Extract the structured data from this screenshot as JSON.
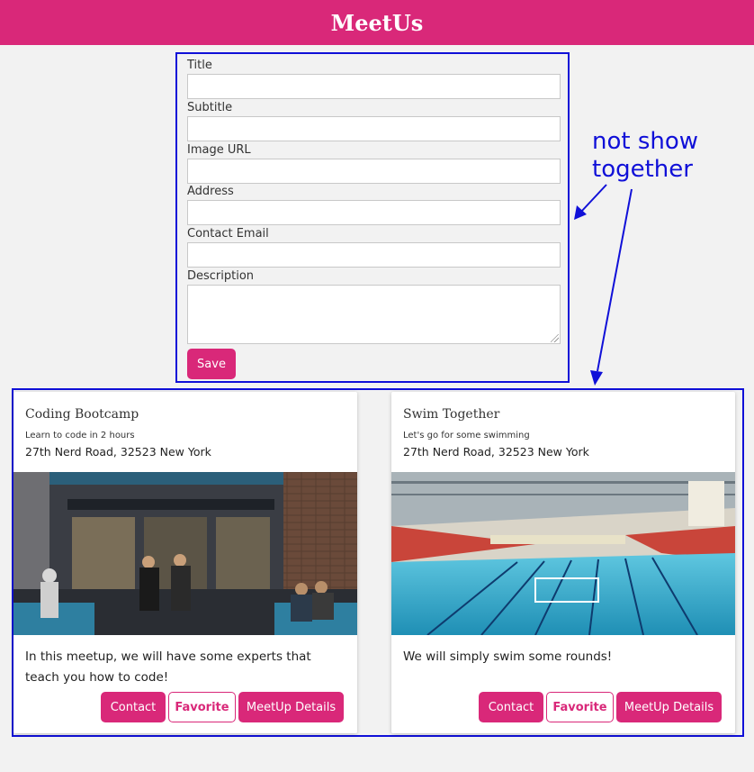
{
  "header": {
    "title": "MeetUs"
  },
  "form": {
    "fields": [
      {
        "label": "Title",
        "value": ""
      },
      {
        "label": "Subtitle",
        "value": ""
      },
      {
        "label": "Image URL",
        "value": ""
      },
      {
        "label": "Address",
        "value": ""
      },
      {
        "label": "Contact Email",
        "value": ""
      },
      {
        "label": "Description",
        "value": ""
      }
    ],
    "save_label": "Save"
  },
  "annotation": {
    "line1": "not show",
    "line2": "together"
  },
  "meetups": [
    {
      "title": "Coding Bootcamp",
      "subtitle": "Learn to code in 2 hours",
      "address": "27th Nerd Road, 32523 New York",
      "description": "In this meetup, we will have some experts that teach you how to code!",
      "contact_label": "Contact",
      "favorite_label": "Favorite",
      "details_label": "MeetUp Details"
    },
    {
      "title": "Swim Together",
      "subtitle": "Let's go for some swimming",
      "address": "27th Nerd Road, 32523 New York",
      "description": "We will simply swim some rounds!",
      "contact_label": "Contact",
      "favorite_label": "Favorite",
      "details_label": "MeetUp Details"
    }
  ],
  "colors": {
    "brand": "#d92879",
    "annotation": "#1010d8",
    "background": "#f2f2f2"
  }
}
